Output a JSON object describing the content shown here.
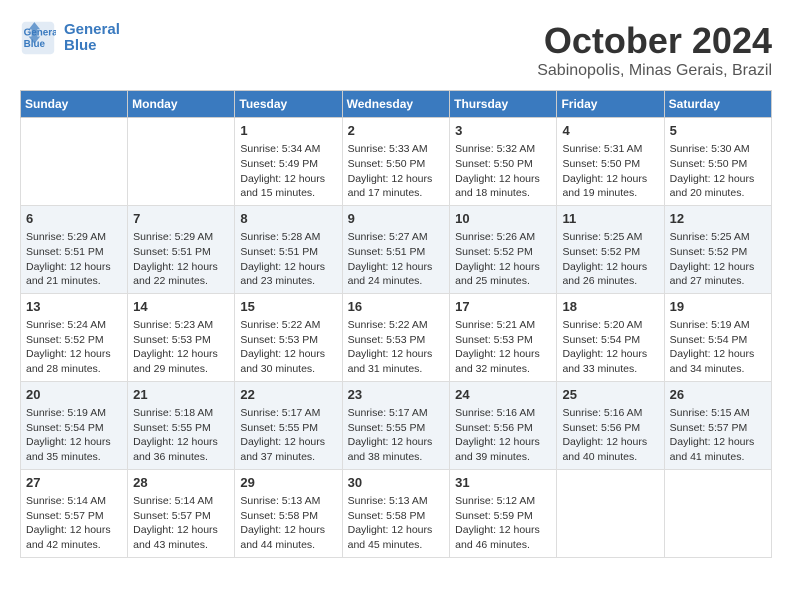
{
  "header": {
    "logo_line1": "General",
    "logo_line2": "Blue",
    "month": "October 2024",
    "location": "Sabinopolis, Minas Gerais, Brazil"
  },
  "weekdays": [
    "Sunday",
    "Monday",
    "Tuesday",
    "Wednesday",
    "Thursday",
    "Friday",
    "Saturday"
  ],
  "rows": [
    [
      {
        "day": "",
        "sunrise": "",
        "sunset": "",
        "daylight": ""
      },
      {
        "day": "",
        "sunrise": "",
        "sunset": "",
        "daylight": ""
      },
      {
        "day": "1",
        "sunrise": "Sunrise: 5:34 AM",
        "sunset": "Sunset: 5:49 PM",
        "daylight": "Daylight: 12 hours and 15 minutes."
      },
      {
        "day": "2",
        "sunrise": "Sunrise: 5:33 AM",
        "sunset": "Sunset: 5:50 PM",
        "daylight": "Daylight: 12 hours and 17 minutes."
      },
      {
        "day": "3",
        "sunrise": "Sunrise: 5:32 AM",
        "sunset": "Sunset: 5:50 PM",
        "daylight": "Daylight: 12 hours and 18 minutes."
      },
      {
        "day": "4",
        "sunrise": "Sunrise: 5:31 AM",
        "sunset": "Sunset: 5:50 PM",
        "daylight": "Daylight: 12 hours and 19 minutes."
      },
      {
        "day": "5",
        "sunrise": "Sunrise: 5:30 AM",
        "sunset": "Sunset: 5:50 PM",
        "daylight": "Daylight: 12 hours and 20 minutes."
      }
    ],
    [
      {
        "day": "6",
        "sunrise": "Sunrise: 5:29 AM",
        "sunset": "Sunset: 5:51 PM",
        "daylight": "Daylight: 12 hours and 21 minutes."
      },
      {
        "day": "7",
        "sunrise": "Sunrise: 5:29 AM",
        "sunset": "Sunset: 5:51 PM",
        "daylight": "Daylight: 12 hours and 22 minutes."
      },
      {
        "day": "8",
        "sunrise": "Sunrise: 5:28 AM",
        "sunset": "Sunset: 5:51 PM",
        "daylight": "Daylight: 12 hours and 23 minutes."
      },
      {
        "day": "9",
        "sunrise": "Sunrise: 5:27 AM",
        "sunset": "Sunset: 5:51 PM",
        "daylight": "Daylight: 12 hours and 24 minutes."
      },
      {
        "day": "10",
        "sunrise": "Sunrise: 5:26 AM",
        "sunset": "Sunset: 5:52 PM",
        "daylight": "Daylight: 12 hours and 25 minutes."
      },
      {
        "day": "11",
        "sunrise": "Sunrise: 5:25 AM",
        "sunset": "Sunset: 5:52 PM",
        "daylight": "Daylight: 12 hours and 26 minutes."
      },
      {
        "day": "12",
        "sunrise": "Sunrise: 5:25 AM",
        "sunset": "Sunset: 5:52 PM",
        "daylight": "Daylight: 12 hours and 27 minutes."
      }
    ],
    [
      {
        "day": "13",
        "sunrise": "Sunrise: 5:24 AM",
        "sunset": "Sunset: 5:52 PM",
        "daylight": "Daylight: 12 hours and 28 minutes."
      },
      {
        "day": "14",
        "sunrise": "Sunrise: 5:23 AM",
        "sunset": "Sunset: 5:53 PM",
        "daylight": "Daylight: 12 hours and 29 minutes."
      },
      {
        "day": "15",
        "sunrise": "Sunrise: 5:22 AM",
        "sunset": "Sunset: 5:53 PM",
        "daylight": "Daylight: 12 hours and 30 minutes."
      },
      {
        "day": "16",
        "sunrise": "Sunrise: 5:22 AM",
        "sunset": "Sunset: 5:53 PM",
        "daylight": "Daylight: 12 hours and 31 minutes."
      },
      {
        "day": "17",
        "sunrise": "Sunrise: 5:21 AM",
        "sunset": "Sunset: 5:53 PM",
        "daylight": "Daylight: 12 hours and 32 minutes."
      },
      {
        "day": "18",
        "sunrise": "Sunrise: 5:20 AM",
        "sunset": "Sunset: 5:54 PM",
        "daylight": "Daylight: 12 hours and 33 minutes."
      },
      {
        "day": "19",
        "sunrise": "Sunrise: 5:19 AM",
        "sunset": "Sunset: 5:54 PM",
        "daylight": "Daylight: 12 hours and 34 minutes."
      }
    ],
    [
      {
        "day": "20",
        "sunrise": "Sunrise: 5:19 AM",
        "sunset": "Sunset: 5:54 PM",
        "daylight": "Daylight: 12 hours and 35 minutes."
      },
      {
        "day": "21",
        "sunrise": "Sunrise: 5:18 AM",
        "sunset": "Sunset: 5:55 PM",
        "daylight": "Daylight: 12 hours and 36 minutes."
      },
      {
        "day": "22",
        "sunrise": "Sunrise: 5:17 AM",
        "sunset": "Sunset: 5:55 PM",
        "daylight": "Daylight: 12 hours and 37 minutes."
      },
      {
        "day": "23",
        "sunrise": "Sunrise: 5:17 AM",
        "sunset": "Sunset: 5:55 PM",
        "daylight": "Daylight: 12 hours and 38 minutes."
      },
      {
        "day": "24",
        "sunrise": "Sunrise: 5:16 AM",
        "sunset": "Sunset: 5:56 PM",
        "daylight": "Daylight: 12 hours and 39 minutes."
      },
      {
        "day": "25",
        "sunrise": "Sunrise: 5:16 AM",
        "sunset": "Sunset: 5:56 PM",
        "daylight": "Daylight: 12 hours and 40 minutes."
      },
      {
        "day": "26",
        "sunrise": "Sunrise: 5:15 AM",
        "sunset": "Sunset: 5:57 PM",
        "daylight": "Daylight: 12 hours and 41 minutes."
      }
    ],
    [
      {
        "day": "27",
        "sunrise": "Sunrise: 5:14 AM",
        "sunset": "Sunset: 5:57 PM",
        "daylight": "Daylight: 12 hours and 42 minutes."
      },
      {
        "day": "28",
        "sunrise": "Sunrise: 5:14 AM",
        "sunset": "Sunset: 5:57 PM",
        "daylight": "Daylight: 12 hours and 43 minutes."
      },
      {
        "day": "29",
        "sunrise": "Sunrise: 5:13 AM",
        "sunset": "Sunset: 5:58 PM",
        "daylight": "Daylight: 12 hours and 44 minutes."
      },
      {
        "day": "30",
        "sunrise": "Sunrise: 5:13 AM",
        "sunset": "Sunset: 5:58 PM",
        "daylight": "Daylight: 12 hours and 45 minutes."
      },
      {
        "day": "31",
        "sunrise": "Sunrise: 5:12 AM",
        "sunset": "Sunset: 5:59 PM",
        "daylight": "Daylight: 12 hours and 46 minutes."
      },
      {
        "day": "",
        "sunrise": "",
        "sunset": "",
        "daylight": ""
      },
      {
        "day": "",
        "sunrise": "",
        "sunset": "",
        "daylight": ""
      }
    ]
  ]
}
